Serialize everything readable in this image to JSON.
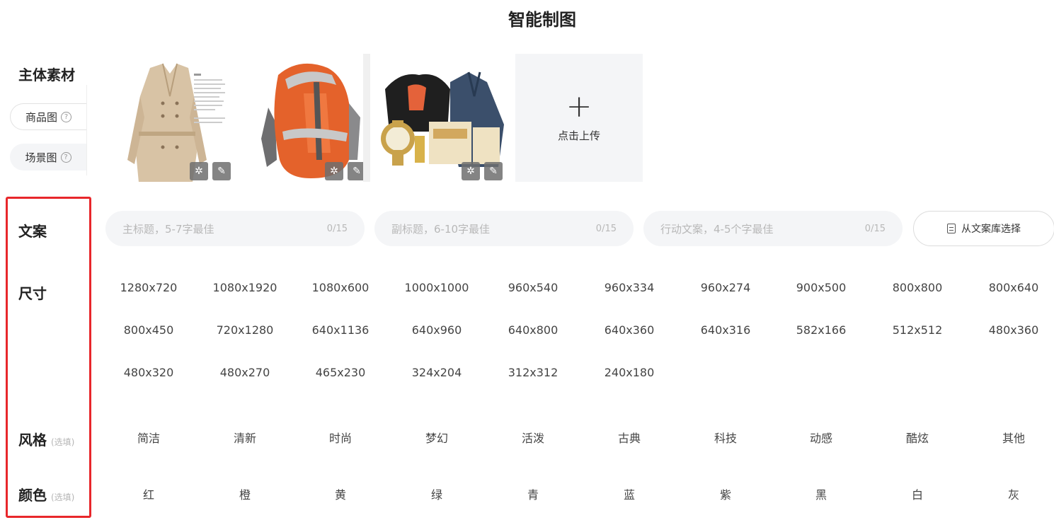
{
  "page": {
    "title": "智能制图"
  },
  "materials": {
    "label": "主体素材",
    "tabs": [
      {
        "label": "商品图",
        "help": "?"
      },
      {
        "label": "场景图",
        "help": "?"
      }
    ],
    "upload_label": "点击上传",
    "upload_icon": "plus-icon",
    "tool_icons": [
      "magic-wand-icon",
      "pencil-icon"
    ],
    "thumbnails": [
      "trench-coat-product-image",
      "orange-backpack-product-image",
      "apparel-watch-combo-product-image"
    ]
  },
  "copy": {
    "label": "文案",
    "inputs": [
      {
        "placeholder": "主标题，5-7字最佳",
        "counter": "0/15"
      },
      {
        "placeholder": "副标题，6-10字最佳",
        "counter": "0/15"
      },
      {
        "placeholder": "行动文案，4-5个字最佳",
        "counter": "0/15"
      }
    ],
    "library_button": "从文案库选择"
  },
  "size": {
    "label": "尺寸",
    "options": [
      "1280x720",
      "1080x1920",
      "1080x600",
      "1000x1000",
      "960x540",
      "960x334",
      "960x274",
      "900x500",
      "800x800",
      "800x640",
      "800x450",
      "720x1280",
      "640x1136",
      "640x960",
      "640x800",
      "640x360",
      "640x316",
      "582x166",
      "512x512",
      "480x360",
      "480x320",
      "480x270",
      "465x230",
      "324x204",
      "312x312",
      "240x180"
    ]
  },
  "style": {
    "label": "风格",
    "optional": "(选填)",
    "options": [
      "简洁",
      "清新",
      "时尚",
      "梦幻",
      "活泼",
      "古典",
      "科技",
      "动感",
      "酷炫",
      "其他"
    ]
  },
  "color": {
    "label": "颜色",
    "optional": "(选填)",
    "options": [
      "红",
      "橙",
      "黄",
      "绿",
      "青",
      "蓝",
      "紫",
      "黑",
      "白",
      "灰"
    ]
  },
  "colors": {
    "highlight": "#e8272b",
    "input_bg": "#f4f5f7"
  }
}
